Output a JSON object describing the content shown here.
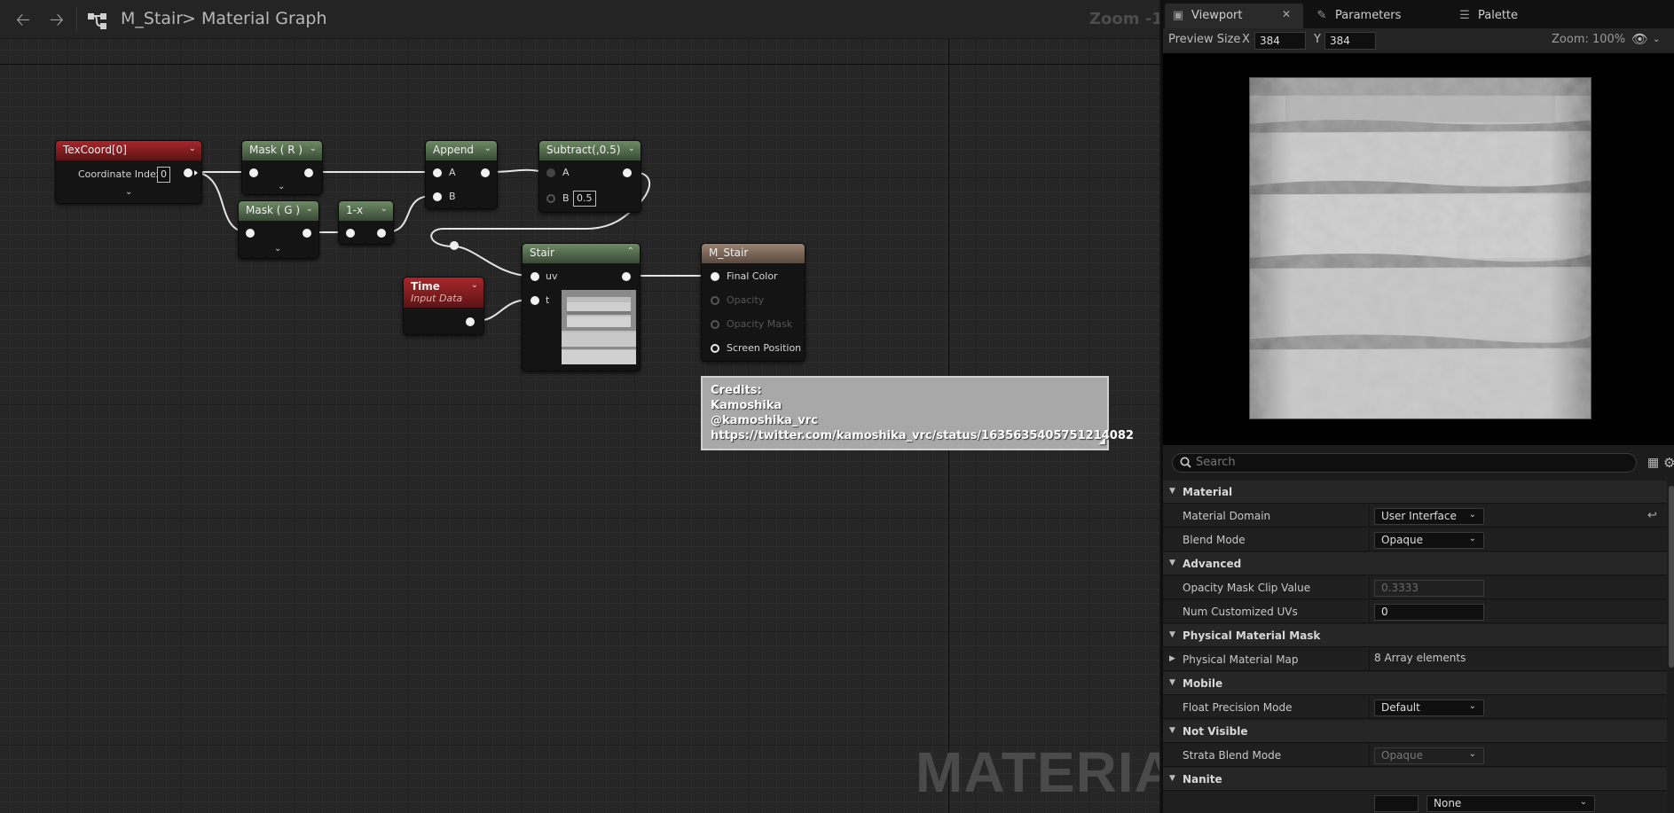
{
  "graph": {
    "breadcrumb": {
      "asset": "M_Stair",
      "separator": ">",
      "page": "Material Graph"
    },
    "zoom": "Zoom -1",
    "watermark": "MATERIAL",
    "nodes": {
      "texcoord": {
        "title": "TexCoord[0]",
        "param_label": "Coordinate Index",
        "param_value": "0"
      },
      "mask_r": {
        "title": "Mask ( R )"
      },
      "mask_g": {
        "title": "Mask ( G )"
      },
      "one_minus": {
        "title": "1-x"
      },
      "append": {
        "title": "Append",
        "pin_a": "A",
        "pin_b": "B"
      },
      "subtract": {
        "title": "Subtract(,0.5)",
        "pin_a": "A",
        "pin_b": "B",
        "b_value": "0.5"
      },
      "time": {
        "title": "Time",
        "subtitle": "Input Data"
      },
      "stair": {
        "title": "Stair",
        "pin_uv": "uv",
        "pin_t": "t"
      },
      "result": {
        "title": "M_Stair",
        "pins": [
          "Final Color",
          "Opacity",
          "Opacity Mask",
          "Screen Position"
        ]
      }
    },
    "comment": {
      "lines": [
        "Credits:",
        "Kamoshika",
        "@kamoshika_vrc",
        "https://twitter.com/kamoshika_vrc/status/1635635405751214082"
      ]
    }
  },
  "tabs": {
    "viewport": "Viewport",
    "parameters": "Parameters",
    "palette": "Palette"
  },
  "viewport_toolbar": {
    "preview_size_label": "Preview Size",
    "x_label": "X",
    "x_value": "384",
    "y_label": "Y",
    "y_value": "384",
    "zoom": "Zoom: 100%"
  },
  "details": {
    "search_placeholder": "Search",
    "rows": [
      {
        "type": "category",
        "label": "Material"
      },
      {
        "type": "combo",
        "label": "Material Domain",
        "value": "User Interface"
      },
      {
        "type": "combo",
        "label": "Blend Mode",
        "value": "Opaque"
      },
      {
        "type": "category",
        "label": "Advanced"
      },
      {
        "type": "number-disabled",
        "label": "Opacity Mask Clip Value",
        "value": "0.3333"
      },
      {
        "type": "number",
        "label": "Num Customized UVs",
        "value": "0"
      },
      {
        "type": "category",
        "label": "Physical Material Mask"
      },
      {
        "type": "array",
        "label": "Physical Material Map",
        "value": "8 Array elements"
      },
      {
        "type": "category",
        "label": "Mobile"
      },
      {
        "type": "combo",
        "label": "Float Precision Mode",
        "value": "Default"
      },
      {
        "type": "category",
        "label": "Not Visible"
      },
      {
        "type": "combo-disabled",
        "label": "Strata Blend Mode",
        "value": "Opaque"
      },
      {
        "type": "category",
        "label": "Nanite"
      }
    ],
    "partial_row": {
      "value": "None"
    }
  },
  "colors": {
    "accent_red": "#a8262a",
    "accent_green": "#6c8a64",
    "result_header": "#9a8270"
  }
}
